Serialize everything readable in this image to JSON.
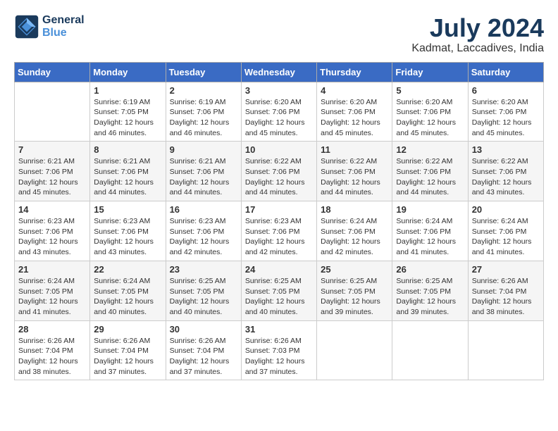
{
  "logo": {
    "line1": "General",
    "line2": "Blue"
  },
  "title": "July 2024",
  "location": "Kadmat, Laccadives, India",
  "days_of_week": [
    "Sunday",
    "Monday",
    "Tuesday",
    "Wednesday",
    "Thursday",
    "Friday",
    "Saturday"
  ],
  "weeks": [
    [
      {
        "num": "",
        "text": ""
      },
      {
        "num": "1",
        "text": "Sunrise: 6:19 AM\nSunset: 7:05 PM\nDaylight: 12 hours\nand 46 minutes."
      },
      {
        "num": "2",
        "text": "Sunrise: 6:19 AM\nSunset: 7:06 PM\nDaylight: 12 hours\nand 46 minutes."
      },
      {
        "num": "3",
        "text": "Sunrise: 6:20 AM\nSunset: 7:06 PM\nDaylight: 12 hours\nand 45 minutes."
      },
      {
        "num": "4",
        "text": "Sunrise: 6:20 AM\nSunset: 7:06 PM\nDaylight: 12 hours\nand 45 minutes."
      },
      {
        "num": "5",
        "text": "Sunrise: 6:20 AM\nSunset: 7:06 PM\nDaylight: 12 hours\nand 45 minutes."
      },
      {
        "num": "6",
        "text": "Sunrise: 6:20 AM\nSunset: 7:06 PM\nDaylight: 12 hours\nand 45 minutes."
      }
    ],
    [
      {
        "num": "7",
        "text": "Sunrise: 6:21 AM\nSunset: 7:06 PM\nDaylight: 12 hours\nand 45 minutes."
      },
      {
        "num": "8",
        "text": "Sunrise: 6:21 AM\nSunset: 7:06 PM\nDaylight: 12 hours\nand 44 minutes."
      },
      {
        "num": "9",
        "text": "Sunrise: 6:21 AM\nSunset: 7:06 PM\nDaylight: 12 hours\nand 44 minutes."
      },
      {
        "num": "10",
        "text": "Sunrise: 6:22 AM\nSunset: 7:06 PM\nDaylight: 12 hours\nand 44 minutes."
      },
      {
        "num": "11",
        "text": "Sunrise: 6:22 AM\nSunset: 7:06 PM\nDaylight: 12 hours\nand 44 minutes."
      },
      {
        "num": "12",
        "text": "Sunrise: 6:22 AM\nSunset: 7:06 PM\nDaylight: 12 hours\nand 44 minutes."
      },
      {
        "num": "13",
        "text": "Sunrise: 6:22 AM\nSunset: 7:06 PM\nDaylight: 12 hours\nand 43 minutes."
      }
    ],
    [
      {
        "num": "14",
        "text": "Sunrise: 6:23 AM\nSunset: 7:06 PM\nDaylight: 12 hours\nand 43 minutes."
      },
      {
        "num": "15",
        "text": "Sunrise: 6:23 AM\nSunset: 7:06 PM\nDaylight: 12 hours\nand 43 minutes."
      },
      {
        "num": "16",
        "text": "Sunrise: 6:23 AM\nSunset: 7:06 PM\nDaylight: 12 hours\nand 42 minutes."
      },
      {
        "num": "17",
        "text": "Sunrise: 6:23 AM\nSunset: 7:06 PM\nDaylight: 12 hours\nand 42 minutes."
      },
      {
        "num": "18",
        "text": "Sunrise: 6:24 AM\nSunset: 7:06 PM\nDaylight: 12 hours\nand 42 minutes."
      },
      {
        "num": "19",
        "text": "Sunrise: 6:24 AM\nSunset: 7:06 PM\nDaylight: 12 hours\nand 41 minutes."
      },
      {
        "num": "20",
        "text": "Sunrise: 6:24 AM\nSunset: 7:06 PM\nDaylight: 12 hours\nand 41 minutes."
      }
    ],
    [
      {
        "num": "21",
        "text": "Sunrise: 6:24 AM\nSunset: 7:05 PM\nDaylight: 12 hours\nand 41 minutes."
      },
      {
        "num": "22",
        "text": "Sunrise: 6:24 AM\nSunset: 7:05 PM\nDaylight: 12 hours\nand 40 minutes."
      },
      {
        "num": "23",
        "text": "Sunrise: 6:25 AM\nSunset: 7:05 PM\nDaylight: 12 hours\nand 40 minutes."
      },
      {
        "num": "24",
        "text": "Sunrise: 6:25 AM\nSunset: 7:05 PM\nDaylight: 12 hours\nand 40 minutes."
      },
      {
        "num": "25",
        "text": "Sunrise: 6:25 AM\nSunset: 7:05 PM\nDaylight: 12 hours\nand 39 minutes."
      },
      {
        "num": "26",
        "text": "Sunrise: 6:25 AM\nSunset: 7:05 PM\nDaylight: 12 hours\nand 39 minutes."
      },
      {
        "num": "27",
        "text": "Sunrise: 6:26 AM\nSunset: 7:04 PM\nDaylight: 12 hours\nand 38 minutes."
      }
    ],
    [
      {
        "num": "28",
        "text": "Sunrise: 6:26 AM\nSunset: 7:04 PM\nDaylight: 12 hours\nand 38 minutes."
      },
      {
        "num": "29",
        "text": "Sunrise: 6:26 AM\nSunset: 7:04 PM\nDaylight: 12 hours\nand 37 minutes."
      },
      {
        "num": "30",
        "text": "Sunrise: 6:26 AM\nSunset: 7:04 PM\nDaylight: 12 hours\nand 37 minutes."
      },
      {
        "num": "31",
        "text": "Sunrise: 6:26 AM\nSunset: 7:03 PM\nDaylight: 12 hours\nand 37 minutes."
      },
      {
        "num": "",
        "text": ""
      },
      {
        "num": "",
        "text": ""
      },
      {
        "num": "",
        "text": ""
      }
    ]
  ]
}
